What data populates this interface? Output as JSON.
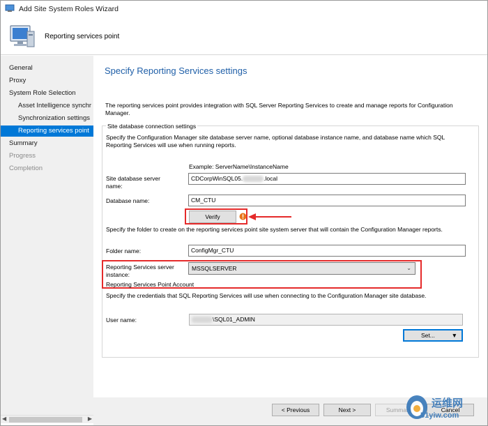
{
  "window": {
    "title": "Add Site System Roles Wizard"
  },
  "banner": {
    "subtitle": "Reporting services point"
  },
  "sidebar": {
    "items": [
      {
        "label": "General",
        "state": "normal"
      },
      {
        "label": "Proxy",
        "state": "normal"
      },
      {
        "label": "System Role Selection",
        "state": "normal"
      },
      {
        "label": "Asset Intelligence synchr",
        "state": "normal"
      },
      {
        "label": "Synchronization settings",
        "state": "normal"
      },
      {
        "label": "Reporting services point",
        "state": "selected"
      },
      {
        "label": "Summary",
        "state": "normal"
      },
      {
        "label": "Progress",
        "state": "disabled"
      },
      {
        "label": "Completion",
        "state": "disabled"
      }
    ]
  },
  "main": {
    "heading": "Specify Reporting Services settings",
    "intro": "The reporting services point provides integration with SQL Server Reporting Services to create and manage reports for Configuration Manager.",
    "db_group": {
      "label": "Site database connection settings",
      "description": "Specify the Configuration Manager site database server name, optional database instance name, and database name which SQL Reporting Services will use when running reports.",
      "example": "Example: ServerName\\InstanceName",
      "server_label": "Site database server name:",
      "server_value_prefix": "CDCorpWinSQL05.",
      "server_value_suffix": ".local",
      "dbname_label": "Database name:",
      "dbname_value": "CM_CTU",
      "verify_label": "Verify",
      "folder_description": "Specify the folder to create on the reporting services point site system server that will contain the Configuration Manager reports.",
      "folder_label": "Folder name:",
      "folder_value": "ConfigMgr_CTU",
      "instance_label": "Reporting Services server instance:",
      "instance_value": "MSSQLSERVER"
    },
    "account_group": {
      "label": "Reporting Services Point Account",
      "description": "Specify the credentials that SQL Reporting Services will use when connecting to the Configuration Manager site database.",
      "username_label": "User name:",
      "username_value": "\\SQL01_ADMIN",
      "set_label": "Set..."
    }
  },
  "footer": {
    "previous_label": "< Previous",
    "next_label": "Next >",
    "summary_label": "Summary",
    "cancel_label": "Cancel"
  },
  "watermark": {
    "text": "运维网",
    "sub": "51yiw.com"
  },
  "colors": {
    "accent": "#0078d7",
    "heading": "#1f5fa8",
    "highlight": "#e52a2a",
    "warning": "#e8741a"
  }
}
